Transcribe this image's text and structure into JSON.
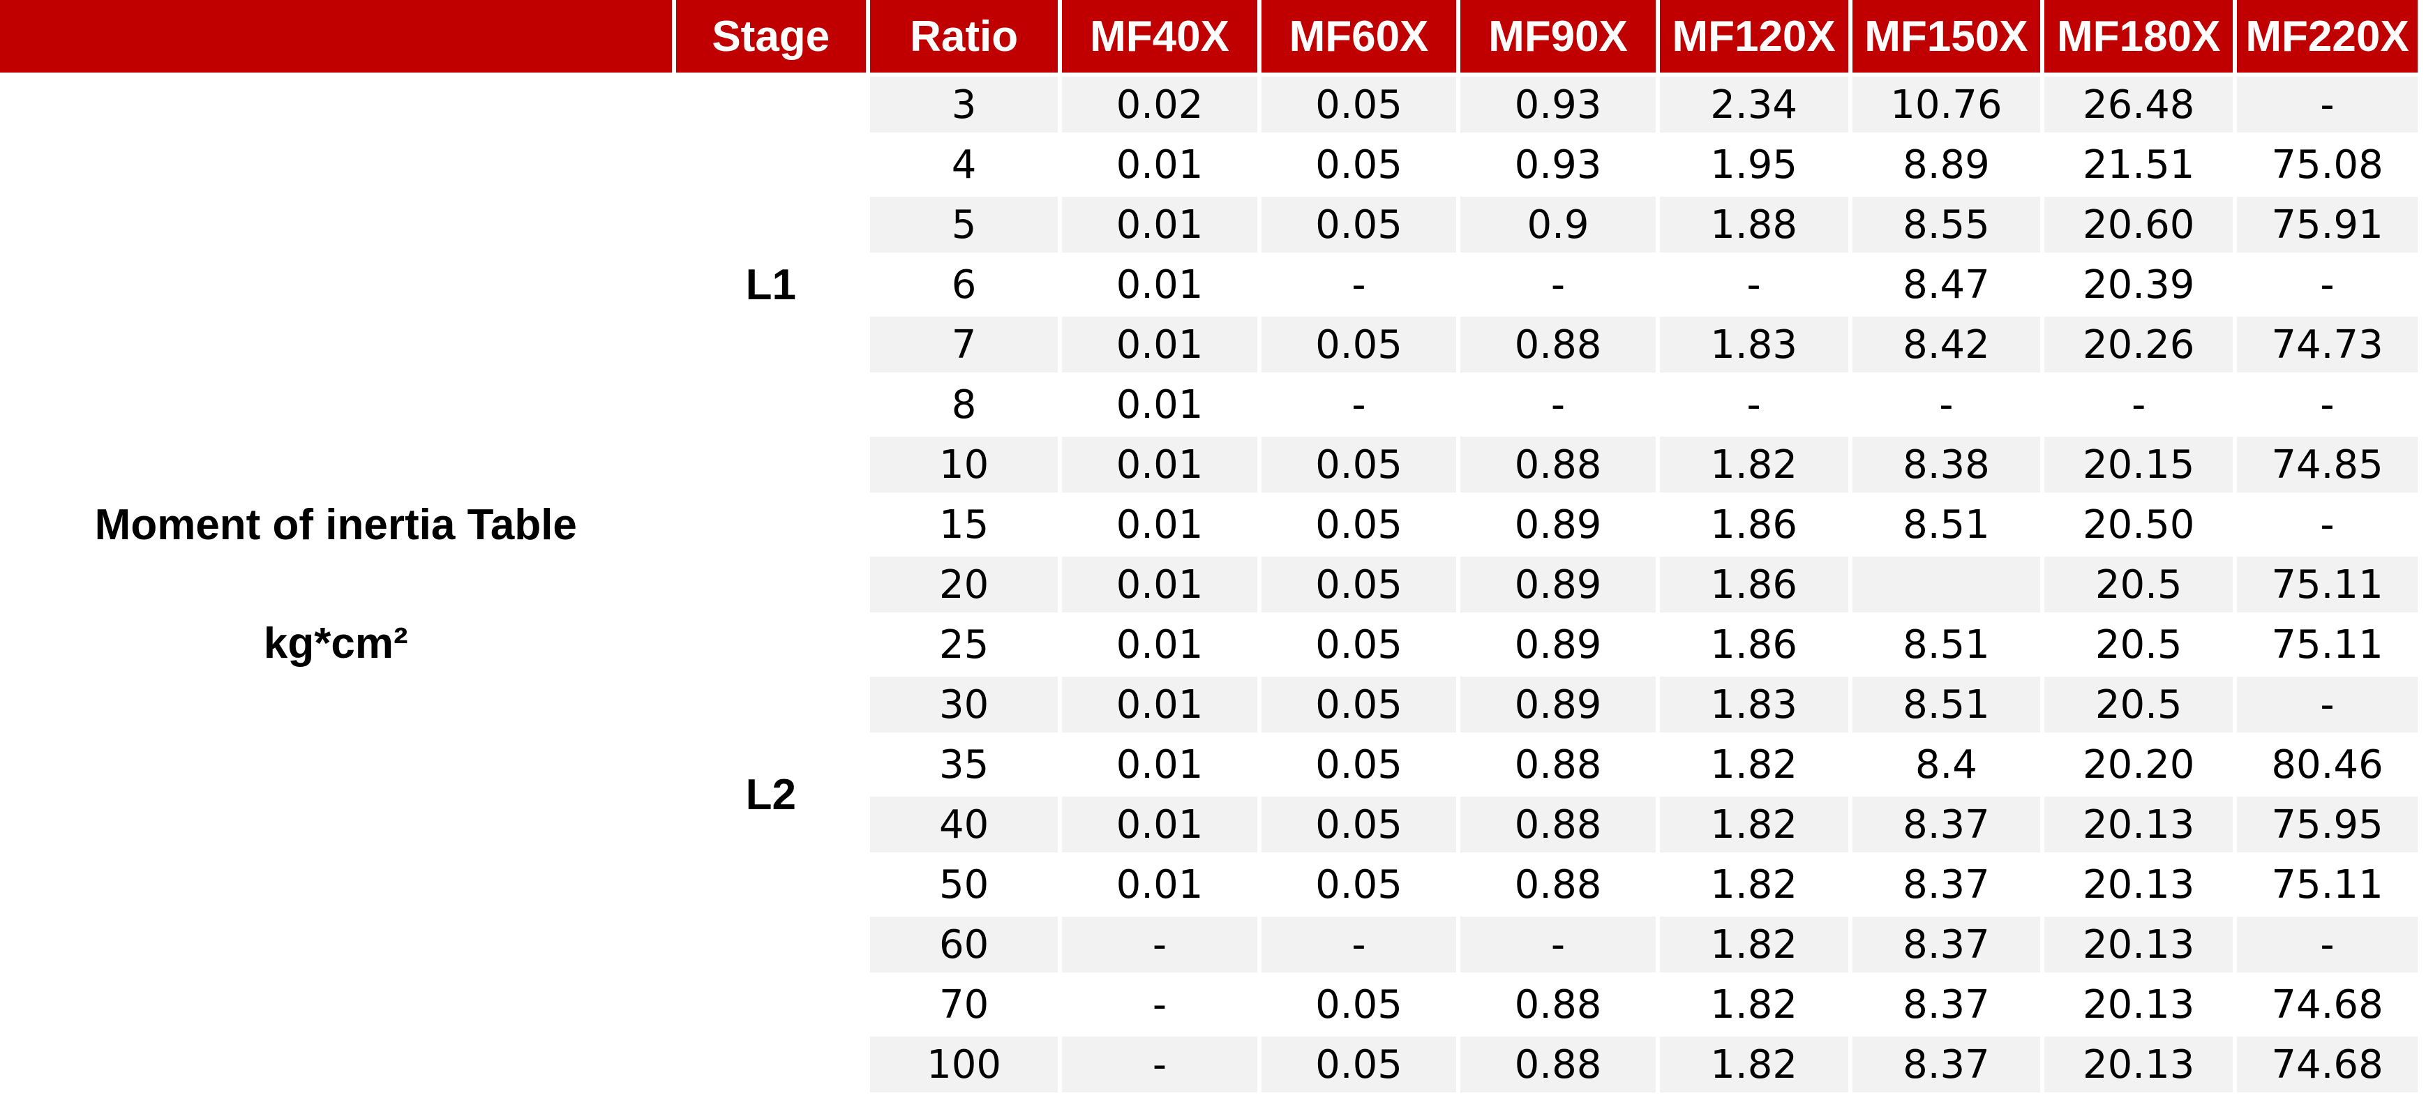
{
  "header": {
    "blank": "",
    "stage": "Stage",
    "ratio": "Ratio",
    "models": [
      "MF40X",
      "MF60X",
      "MF90X",
      "MF120X",
      "MF150X",
      "MF180X",
      "MF220X"
    ]
  },
  "label": {
    "title": "Moment of inertia Table",
    "unit": "kg*cm²"
  },
  "stages": [
    {
      "name": "L1",
      "rows": [
        {
          "ratio": "3",
          "values": [
            "0.02",
            "0.05",
            "0.93",
            "2.34",
            "10.76",
            "26.48",
            "-"
          ]
        },
        {
          "ratio": "4",
          "values": [
            "0.01",
            "0.05",
            "0.93",
            "1.95",
            "8.89",
            "21.51",
            "75.08"
          ]
        },
        {
          "ratio": "5",
          "values": [
            "0.01",
            "0.05",
            "0.9",
            "1.88",
            "8.55",
            "20.60",
            "75.91"
          ]
        },
        {
          "ratio": "6",
          "values": [
            "0.01",
            "-",
            "-",
            "-",
            "8.47",
            "20.39",
            "-"
          ]
        },
        {
          "ratio": "7",
          "values": [
            "0.01",
            "0.05",
            "0.88",
            "1.83",
            "8.42",
            "20.26",
            "74.73"
          ]
        },
        {
          "ratio": "8",
          "values": [
            "0.01",
            "-",
            "-",
            "-",
            "-",
            "-",
            "-"
          ]
        },
        {
          "ratio": "10",
          "values": [
            "0.01",
            "0.05",
            "0.88",
            "1.82",
            "8.38",
            "20.15",
            "74.85"
          ]
        }
      ]
    },
    {
      "name": "L2",
      "rows": [
        {
          "ratio": "15",
          "values": [
            "0.01",
            "0.05",
            "0.89",
            "1.86",
            "8.51",
            "20.50",
            "-"
          ]
        },
        {
          "ratio": "20",
          "values": [
            "0.01",
            "0.05",
            "0.89",
            "1.86",
            "",
            "20.5",
            "75.11"
          ]
        },
        {
          "ratio": "25",
          "values": [
            "0.01",
            "0.05",
            "0.89",
            "1.86",
            "8.51",
            "20.5",
            "75.11"
          ]
        },
        {
          "ratio": "30",
          "values": [
            "0.01",
            "0.05",
            "0.89",
            "1.83",
            "8.51",
            "20.5",
            "-"
          ]
        },
        {
          "ratio": "35",
          "values": [
            "0.01",
            "0.05",
            "0.88",
            "1.82",
            "8.4",
            "20.20",
            "80.46"
          ]
        },
        {
          "ratio": "40",
          "values": [
            "0.01",
            "0.05",
            "0.88",
            "1.82",
            "8.37",
            "20.13",
            "75.95"
          ]
        },
        {
          "ratio": "50",
          "values": [
            "0.01",
            "0.05",
            "0.88",
            "1.82",
            "8.37",
            "20.13",
            "75.11"
          ]
        },
        {
          "ratio": "60",
          "values": [
            "-",
            "-",
            "-",
            "1.82",
            "8.37",
            "20.13",
            "-"
          ]
        },
        {
          "ratio": "70",
          "values": [
            "-",
            "0.05",
            "0.88",
            "1.82",
            "8.37",
            "20.13",
            "74.68"
          ]
        },
        {
          "ratio": "100",
          "values": [
            "-",
            "0.05",
            "0.88",
            "1.82",
            "8.37",
            "20.13",
            "74.68"
          ]
        }
      ]
    }
  ],
  "colors": {
    "header_background": "#c00000",
    "header_text": "#ffffff",
    "row_stripe": "#f2f2f2",
    "row_plain": "#ffffff"
  }
}
